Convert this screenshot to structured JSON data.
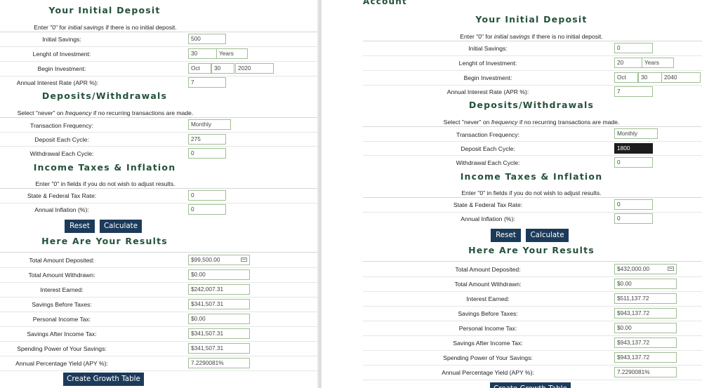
{
  "left": {
    "sections": {
      "deposit": "Your Initial Deposit",
      "deposits_withdrawals": "Deposits/Withdrawals",
      "taxes": "Income Taxes & Inflation",
      "results": "Here Are Your Results"
    },
    "notes": {
      "deposit_pre": "Enter \"0\" for ",
      "deposit_em": "initial savings",
      "deposit_post": " if there is no initial deposit.",
      "freq_pre": "Select \"never\" on ",
      "freq_em": "frequency",
      "freq_post": " if no recurring transactions are made.",
      "taxes": "Enter \"0\" in fields if you do not wish to adjust results."
    },
    "labels": {
      "initial_savings": "Initial Savings:",
      "length": "Lenght of Investment:",
      "begin": "Begin Investment:",
      "apr": "Annual Interest Rate (APR %):",
      "frequency": "Transaction Frequency:",
      "deposit_cycle": "Deposit Each Cycle:",
      "withdrawal_cycle": "Withdrawal Each Cycle:",
      "tax_rate": "State & Federal Tax Rate:",
      "inflation": "Annual Inflation (%):",
      "total_deposited": "Total Amount Deposited:",
      "total_withdrawn": "Total Amount Withdrawn:",
      "interest_earned": "Interest Earned:",
      "savings_before": "Savings Before Taxes:",
      "personal_tax": "Personal Income Tax:",
      "savings_after": "Savings After Income Tax:",
      "spending_power": "Spending Power of Your Savings:",
      "apy": "Annual Percentage Yield (APY %):"
    },
    "values": {
      "initial_savings": "500",
      "length": "30",
      "length_unit": "Years",
      "begin_month": "Oct",
      "begin_day": "30",
      "begin_year": "2020",
      "apr": "7",
      "frequency": "Monthly",
      "deposit_cycle": "275",
      "withdrawal_cycle": "0",
      "tax_rate": "0",
      "inflation": "0",
      "total_deposited": "$99,500.00",
      "total_withdrawn": "$0.00",
      "interest_earned": "$242,007.31",
      "savings_before": "$341,507.31",
      "personal_tax": "$0.00",
      "savings_after": "$341,507.31",
      "spending_power": "$341,507.31",
      "apy": "7.2290081%"
    },
    "buttons": {
      "reset": "Reset",
      "calculate": "Calculate",
      "growth": "Create Growth Table"
    }
  },
  "right": {
    "account_heading": "Account",
    "values": {
      "initial_savings": "0",
      "length": "20",
      "length_unit": "Years",
      "begin_month": "Oct",
      "begin_day": "30",
      "begin_year": "2040",
      "apr": "7",
      "frequency": "Monthly",
      "deposit_cycle": "1800",
      "withdrawal_cycle": "0",
      "tax_rate": "0",
      "inflation": "0",
      "total_deposited": "$432,000.00",
      "total_withdrawn": "$0.00",
      "interest_earned": "$511,137.72",
      "savings_before": "$943,137.72",
      "personal_tax": "$0.00",
      "savings_after": "$943,137.72",
      "spending_power": "$943,137.72",
      "apy": "7.2290081%"
    },
    "buttons": {
      "reset": "Reset",
      "calculate": "Calculate",
      "growth": "Create Growth Table"
    }
  }
}
